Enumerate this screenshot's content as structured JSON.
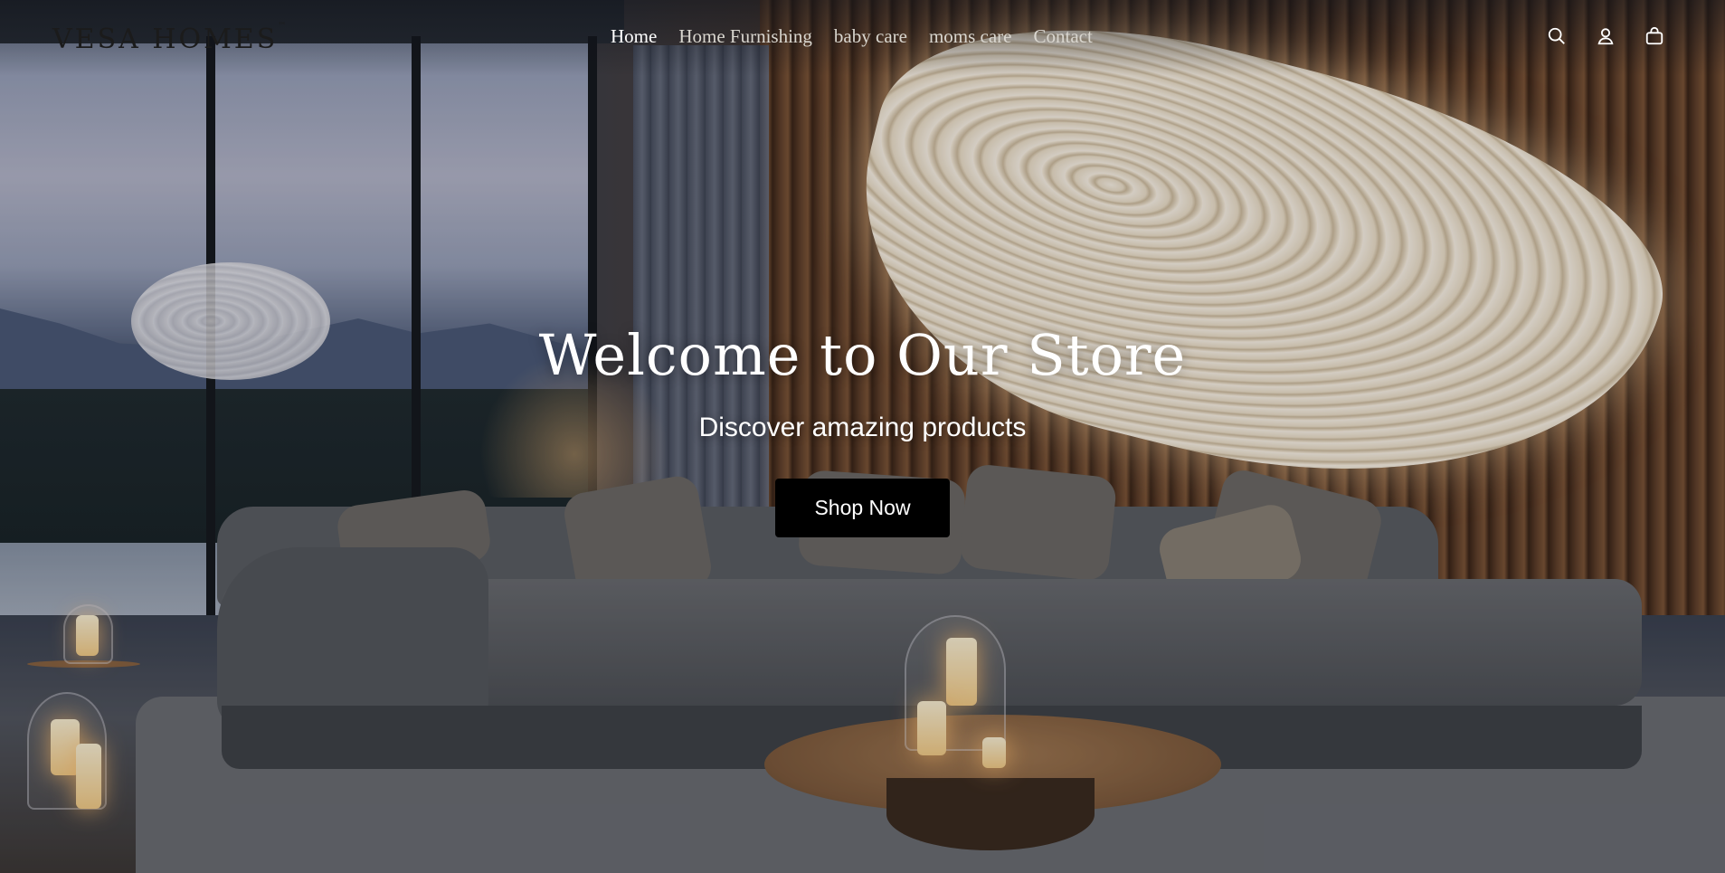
{
  "header": {
    "logo_text": "VESA HOMES",
    "nav": [
      {
        "label": "Home",
        "active": true
      },
      {
        "label": "Home Furnishing",
        "active": false
      },
      {
        "label": "baby care",
        "active": false
      },
      {
        "label": "moms care",
        "active": false
      },
      {
        "label": "Contact",
        "active": false
      }
    ],
    "icons": [
      "search-icon",
      "account-icon",
      "cart-icon"
    ]
  },
  "hero": {
    "title": "Welcome to Our Store",
    "subtitle": "Discover amazing products",
    "button_label": "Shop Now"
  },
  "colors": {
    "button_bg": "#000000",
    "text": "#ffffff",
    "nav_text": "#d9d6cf",
    "logo_accent": "#b9773b"
  }
}
